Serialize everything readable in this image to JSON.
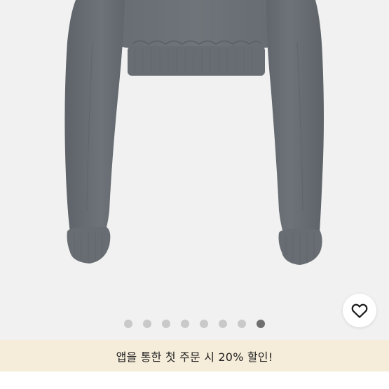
{
  "product_gallery": {
    "image_subject": "gray cropped sweatshirt, back view",
    "slide_count": 8,
    "active_slide": 8,
    "dots": [
      {
        "state": "inactive"
      },
      {
        "state": "inactive"
      },
      {
        "state": "inactive"
      },
      {
        "state": "inactive"
      },
      {
        "state": "inactive"
      },
      {
        "state": "inactive"
      },
      {
        "state": "inactive"
      },
      {
        "state": "active"
      }
    ]
  },
  "wishlist": {
    "icon": "heart-outline-icon"
  },
  "promo_banner": {
    "text": "앱을 통한 첫 주문 시 20% 할인!"
  },
  "colors": {
    "background": "#f1f1f1",
    "garment": "#6c7176",
    "banner": "#f5ecd9",
    "dot_inactive": "#c9c9c9",
    "dot_active": "#6f6f6f"
  }
}
